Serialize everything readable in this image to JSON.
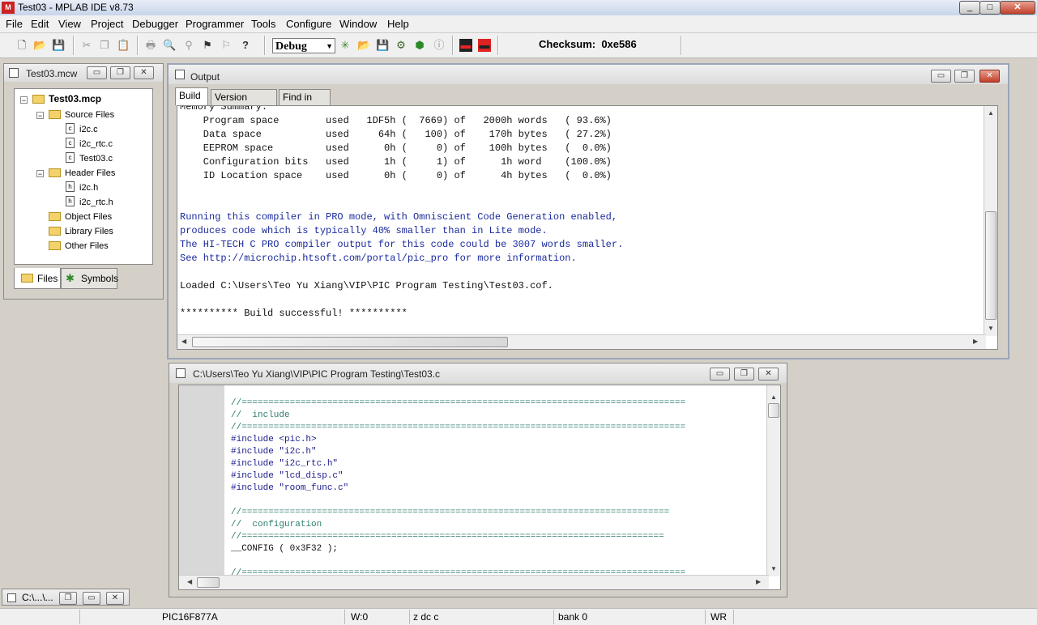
{
  "app": {
    "title": "Test03 - MPLAB IDE v8.73",
    "icon_text": "M",
    "window_buttons": [
      "_",
      "□",
      "✕"
    ]
  },
  "menu": [
    "File",
    "Edit",
    "View",
    "Project",
    "Debugger",
    "Programmer",
    "Tools",
    "Configure",
    "Window",
    "Help"
  ],
  "toolbar": {
    "config_value": "Debug",
    "checksum_label": "Checksum:",
    "checksum_value": "0xe586",
    "icons": [
      "new-file-icon",
      "open-folder-icon",
      "save-icon",
      "cut-icon",
      "copy-icon",
      "paste-icon",
      "print-icon",
      "find-icon",
      "find-in-files-icon",
      "bookmark-icon",
      "toggle-bookmark-icon",
      "help-icon",
      "new-project-icon",
      "open-project-icon",
      "save-workspace-icon",
      "build-icon",
      "rebuild-icon",
      "info-icon",
      "debug-red-icon",
      "program-red-icon"
    ]
  },
  "workspace": {
    "title": "Test03.mcw",
    "project": "Test03.mcp",
    "tree": [
      {
        "label": "Source Files",
        "type": "folder",
        "level": 1
      },
      {
        "label": "i2c.c",
        "type": "file-c",
        "level": 2
      },
      {
        "label": "i2c_rtc.c",
        "type": "file-c",
        "level": 2
      },
      {
        "label": "Test03.c",
        "type": "file-c",
        "level": 2
      },
      {
        "label": "Header Files",
        "type": "folder",
        "level": 1
      },
      {
        "label": "i2c.h",
        "type": "file-h",
        "level": 2
      },
      {
        "label": "i2c_rtc.h",
        "type": "file-h",
        "level": 2
      },
      {
        "label": "Object Files",
        "type": "folder",
        "level": 1
      },
      {
        "label": "Library Files",
        "type": "folder",
        "level": 1
      },
      {
        "label": "Other Files",
        "type": "folder",
        "level": 1
      }
    ],
    "tabs": [
      "Files",
      "Symbols"
    ]
  },
  "output": {
    "title": "Output",
    "tabs": [
      "Build",
      "Version Control",
      "Find in Files"
    ],
    "lines": [
      {
        "text": "Memory Summary:",
        "color": "#111111",
        "partial": true
      },
      {
        "text": "    Program space        used   1DF5h (  7669) of   2000h words   ( 93.6%)",
        "color": "#111111"
      },
      {
        "text": "    Data space           used     64h (   100) of    170h bytes   ( 27.2%)",
        "color": "#111111"
      },
      {
        "text": "    EEPROM space         used      0h (     0) of    100h bytes   (  0.0%)",
        "color": "#111111"
      },
      {
        "text": "    Configuration bits   used      1h (     1) of      1h word    (100.0%)",
        "color": "#111111"
      },
      {
        "text": "    ID Location space    used      0h (     0) of      4h bytes   (  0.0%)",
        "color": "#111111"
      },
      {
        "text": "",
        "color": "#111111"
      },
      {
        "text": "",
        "color": "#111111"
      },
      {
        "text": "Running this compiler in PRO mode, with Omniscient Code Generation enabled,",
        "color": "#1a2a9c"
      },
      {
        "text": "produces code which is typically 40% smaller than in Lite mode.",
        "color": "#1a2a9c"
      },
      {
        "text": "The HI-TECH C PRO compiler output for this code could be 3007 words smaller.",
        "color": "#1a2a9c"
      },
      {
        "text": "See http://microchip.htsoft.com/portal/pic_pro for more information.",
        "color": "#1a2a9c"
      },
      {
        "text": "",
        "color": "#111111"
      },
      {
        "text": "Loaded C:\\Users\\Teo Yu Xiang\\VIP\\PIC Program Testing\\Test03.cof.",
        "color": "#111111"
      },
      {
        "text": "",
        "color": "#111111"
      },
      {
        "text": "********** Build successful! **********",
        "color": "#111111"
      }
    ]
  },
  "editor": {
    "title": "C:\\Users\\Teo Yu Xiang\\VIP\\PIC Program Testing\\Test03.c",
    "lines": [
      {
        "text": "//===================================================================================",
        "cls": "c-comment"
      },
      {
        "text": "//  include",
        "cls": "c-comment"
      },
      {
        "text": "//===================================================================================",
        "cls": "c-comment"
      },
      {
        "text": "#include <pic.h>",
        "cls": "c-pre"
      },
      {
        "text": "#include \"i2c.h\"",
        "cls": "c-pre"
      },
      {
        "text": "#include \"i2c_rtc.h\"",
        "cls": "c-pre"
      },
      {
        "text": "#include \"lcd_disp.c\"",
        "cls": "c-pre"
      },
      {
        "text": "#include \"room_func.c\"",
        "cls": "c-pre"
      },
      {
        "text": "",
        "cls": "c-dark"
      },
      {
        "text": "//================================================================================",
        "cls": "c-comment"
      },
      {
        "text": "//  configuration",
        "cls": "c-comment"
      },
      {
        "text": "//===============================================================================",
        "cls": "c-comment"
      },
      {
        "text": "__CONFIG ( 0x3F32 );",
        "cls": "c-dark"
      },
      {
        "text": "",
        "cls": "c-dark"
      },
      {
        "text": "//===================================================================================",
        "cls": "c-comment"
      }
    ]
  },
  "minimized": {
    "title": "C:\\...\\..."
  },
  "status": {
    "device": "PIC16F877A",
    "w": "W:0",
    "flags": "z dc c",
    "bank": "bank 0",
    "mode": "WR"
  }
}
